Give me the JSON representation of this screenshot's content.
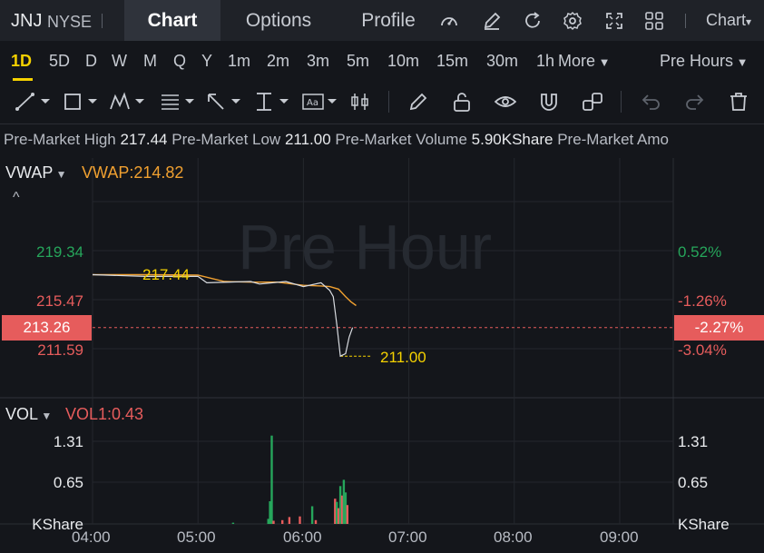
{
  "header": {
    "symbol": "JNJ",
    "exchange": "NYSE",
    "tabs": [
      {
        "label": "Chart",
        "active": true
      },
      {
        "label": "Options",
        "active": false
      },
      {
        "label": "Profile",
        "active": false
      }
    ],
    "chart_type_label": "Chart"
  },
  "periods": {
    "items": [
      "1D",
      "5D",
      "D",
      "W",
      "M",
      "Q",
      "Y",
      "1m",
      "2m",
      "3m",
      "5m",
      "10m",
      "15m",
      "30m",
      "1h"
    ],
    "active": "1D",
    "more_label": "More",
    "session_label": "Pre Hours"
  },
  "info_bar": {
    "high_label": "Pre-Market High",
    "high_value": "217.44",
    "low_label": "Pre-Market Low",
    "low_value": "211.00",
    "volume_label": "Pre-Market Volume",
    "volume_value": "5.90KShare",
    "amount_label": "Pre-Market Amo"
  },
  "price_panel": {
    "indicator": "VWAP",
    "indicator_value": "VWAP:214.82",
    "watermark": "Pre Hour",
    "price_ticks": [
      "219.34",
      "215.47",
      "211.59"
    ],
    "pct_ticks": [
      "0.52%",
      "-1.26%",
      "-3.04%"
    ],
    "current_price": "213.26",
    "current_pct": "-2.27%",
    "high_annotation": "217.44",
    "low_annotation": "211.00"
  },
  "volume_panel": {
    "indicator": "VOL",
    "indicator_value": "VOL1:0.43",
    "ticks": [
      "1.31",
      "0.65"
    ],
    "unit": "KShare"
  },
  "x_ticks": [
    "04:00",
    "05:00",
    "06:00",
    "07:00",
    "08:00",
    "09:00"
  ],
  "colors": {
    "up": "#26a65b",
    "down": "#e65c5c",
    "vwap": "#f0a030",
    "accent": "#f5d100",
    "price_line": "#d8dbe0"
  },
  "chart_data": [
    {
      "type": "line",
      "x_range": [
        "04:00",
        "09:30"
      ],
      "ylim": [
        210.0,
        221.0
      ],
      "series": [
        {
          "name": "VWAP",
          "x": [
            "04:00",
            "04:30",
            "05:00",
            "05:15",
            "05:30",
            "05:45",
            "06:00",
            "06:10",
            "06:15",
            "06:20",
            "06:24",
            "06:27",
            "06:30"
          ],
          "values": [
            217.44,
            217.44,
            217.4,
            216.9,
            216.85,
            216.85,
            216.6,
            216.55,
            216.5,
            216.3,
            215.7,
            215.3,
            215.0
          ]
        },
        {
          "x": [
            "04:00",
            "04:30",
            "05:00",
            "05:05",
            "05:30",
            "05:35",
            "05:50",
            "06:00",
            "06:10",
            "06:15",
            "06:17",
            "06:19",
            "06:21",
            "06:24",
            "06:26",
            "06:28"
          ],
          "values": [
            217.44,
            217.3,
            217.3,
            216.8,
            216.9,
            216.7,
            216.9,
            216.5,
            216.8,
            216.2,
            215.7,
            213.5,
            211.0,
            211.2,
            212.5,
            213.26
          ]
        }
      ]
    },
    {
      "type": "bar",
      "unit": "KShare",
      "ylim": [
        0,
        1.45
      ],
      "x": [
        "05:20",
        "05:40",
        "05:41",
        "05:42",
        "05:43",
        "05:48",
        "05:52",
        "05:58",
        "06:05",
        "06:07",
        "06:18",
        "06:19",
        "06:20",
        "06:21",
        "06:22",
        "06:23",
        "06:24",
        "06:25"
      ],
      "values": [
        0.02,
        0.08,
        0.36,
        1.4,
        0.05,
        0.06,
        0.11,
        0.12,
        0.28,
        0.06,
        0.4,
        0.35,
        0.25,
        0.6,
        0.45,
        0.7,
        0.5,
        0.3
      ],
      "direction": [
        "up",
        "up",
        "up",
        "up",
        "down",
        "down",
        "down",
        "down",
        "up",
        "down",
        "down",
        "up",
        "down",
        "up",
        "down",
        "up",
        "up",
        "down"
      ]
    }
  ]
}
